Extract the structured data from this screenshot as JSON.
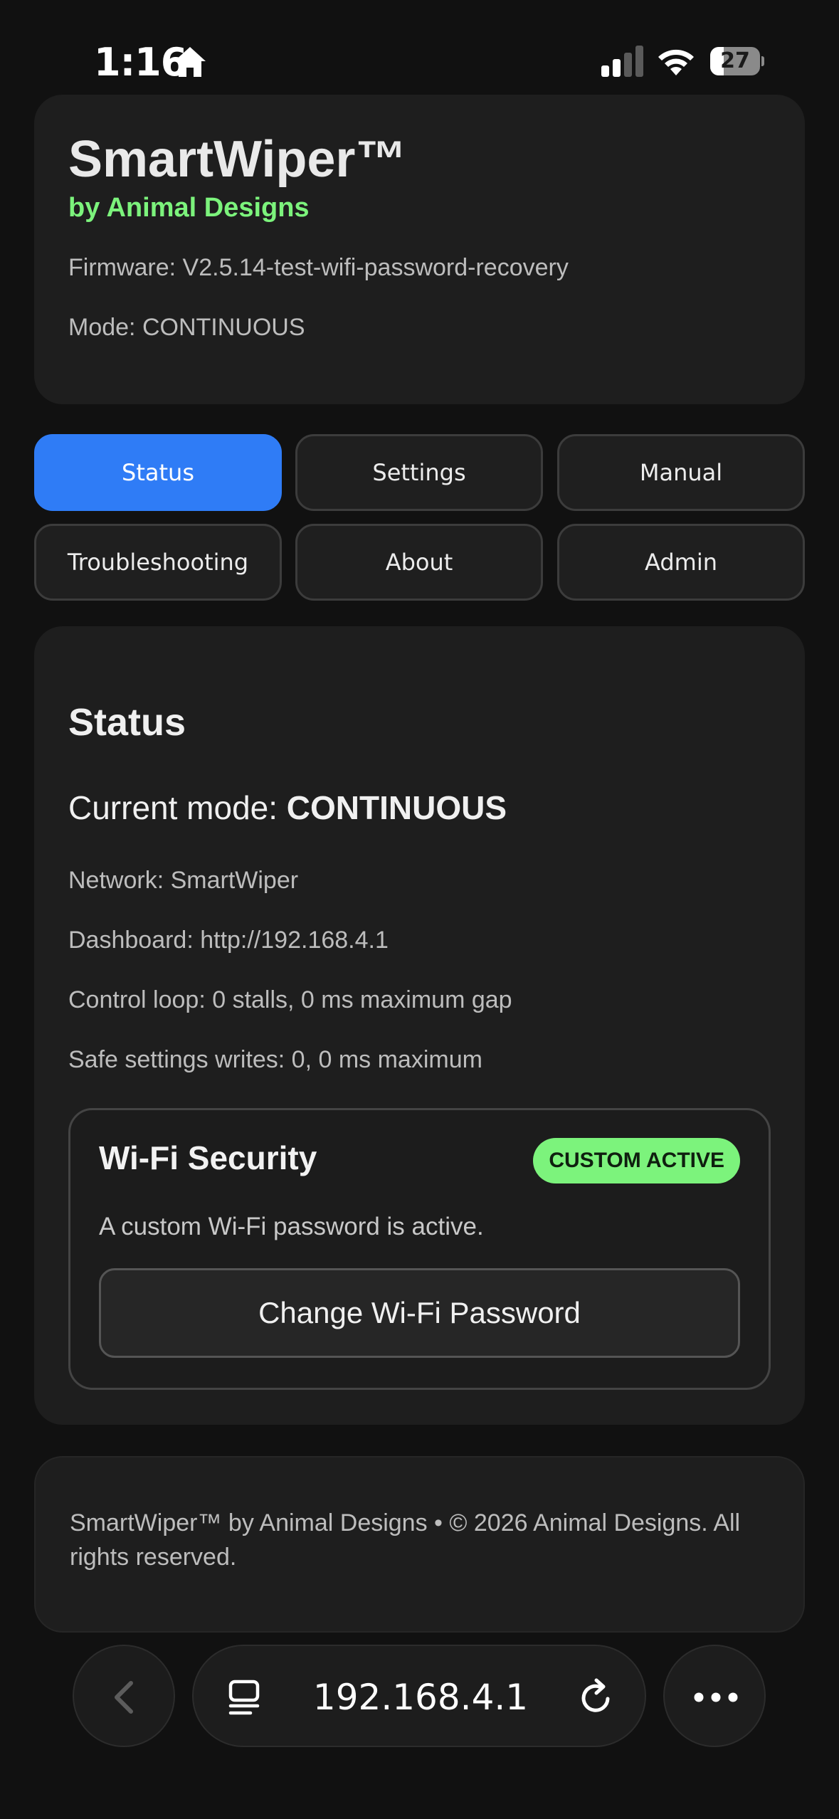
{
  "statusbar": {
    "time": "1:16",
    "battery_level": "27",
    "battery_fraction": 0.27,
    "icons": [
      "home-icon",
      "cellular-signal-icon",
      "wifi-icon",
      "battery-icon"
    ]
  },
  "header": {
    "title": "SmartWiper™",
    "subtitle": "by Animal Designs",
    "firmware": "Firmware: V2.5.14-test-wifi-password-recovery",
    "mode": "Mode: CONTINUOUS"
  },
  "tabs": [
    {
      "label": "Status",
      "active": true
    },
    {
      "label": "Settings",
      "active": false
    },
    {
      "label": "Manual",
      "active": false
    },
    {
      "label": "Troubleshooting",
      "active": false
    },
    {
      "label": "About",
      "active": false
    },
    {
      "label": "Admin",
      "active": false
    }
  ],
  "status": {
    "title": "Status",
    "mode_prefix": "Current mode: ",
    "mode_value": "CONTINUOUS",
    "network": "Network: SmartWiper",
    "dashboard": "Dashboard: http://192.168.4.1",
    "control_loop": "Control loop: 0 stalls, 0 ms maximum gap",
    "safe_writes": "Safe settings writes: 0, 0 ms maximum"
  },
  "wifi_security": {
    "title": "Wi-Fi Security",
    "badge": "CUSTOM ACTIVE",
    "text": "A custom Wi-Fi password is active.",
    "button_label": "Change Wi-Fi Password"
  },
  "footer": {
    "text": "SmartWiper™ by Animal Designs • © 2026 Animal Designs. All rights reserved."
  },
  "browser": {
    "url": "192.168.4.1"
  },
  "colors": {
    "background": "#111111",
    "card": "#1e1e1e",
    "accent_blue": "#2f7cf6",
    "accent_green": "#7cf37c"
  }
}
